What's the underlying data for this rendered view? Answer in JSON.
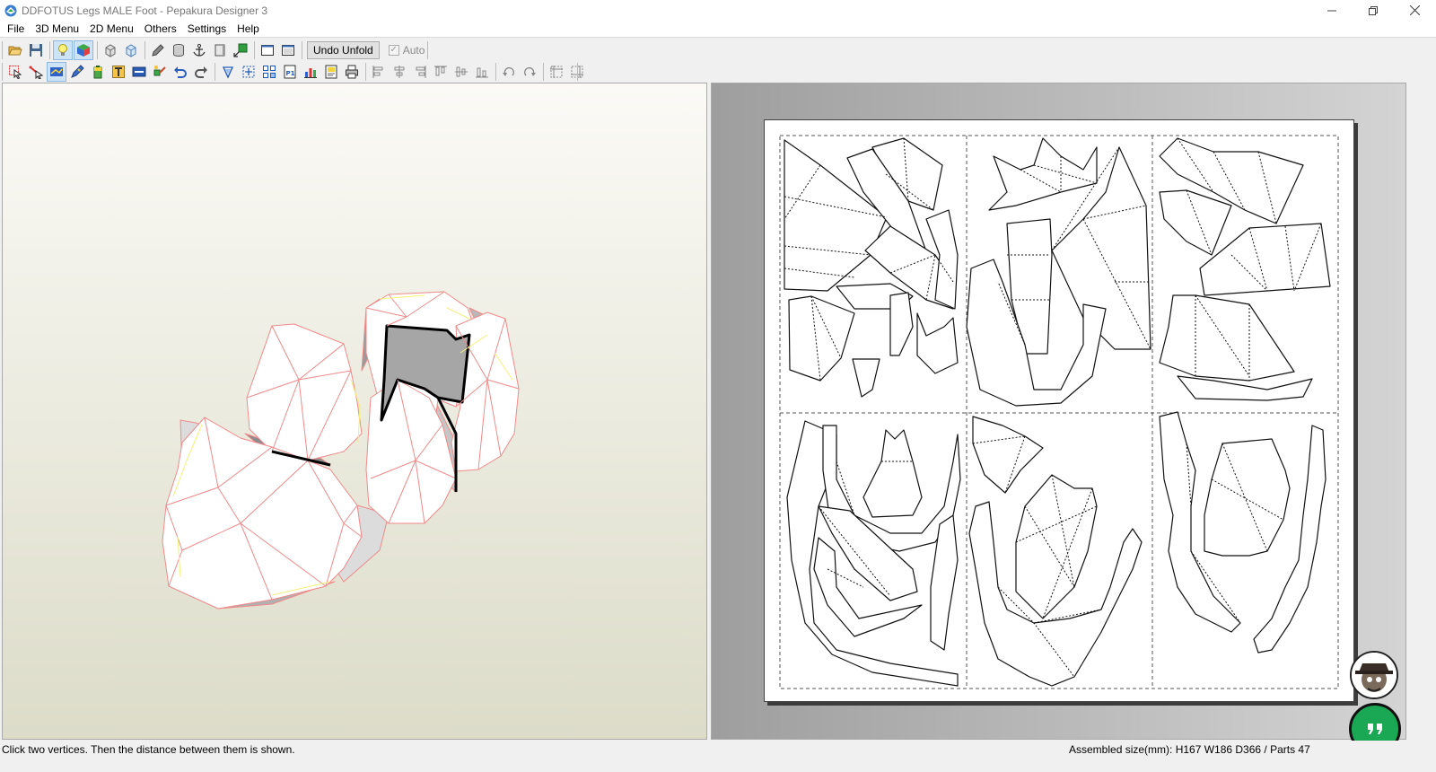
{
  "window": {
    "title": "DDFOTUS Legs MALE Foot - Pepakura Designer 3",
    "minimize_icon": "minimize-icon",
    "maximize_icon": "restore-icon",
    "close_icon": "close-icon"
  },
  "menu": {
    "items": [
      "File",
      "3D Menu",
      "2D Menu",
      "Others",
      "Settings",
      "Help"
    ]
  },
  "toolbar1": {
    "undo_unfold_label": "Undo Unfold",
    "auto_label": "Auto",
    "auto_checked": true,
    "icons": [
      "open-file-icon",
      "save-icon",
      "light-icon",
      "texture-cube-icon",
      "unfold-icon",
      "paper-cube-icon",
      "pencil-icon",
      "cylinder-icon",
      "anchor-icon",
      "box-icon",
      "green-box-icon",
      "single-view-icon",
      "split-view-icon"
    ]
  },
  "toolbar2": {
    "icons": [
      "select-icon",
      "edge-select-icon",
      "fold-lines-icon",
      "pencil-tool-icon",
      "battery-icon",
      "text-tool-icon",
      "image-icon",
      "join-icon",
      "undo-icon",
      "redo-icon",
      "rotate-part-icon",
      "move-part-icon",
      "scale-part-icon",
      "page-p1-icon",
      "chart-icon",
      "print-preview-icon",
      "print-icon",
      "align-left-icon",
      "align-center-icon",
      "align-right-icon",
      "align-top-icon",
      "align-middle-icon",
      "align-bottom-icon",
      "rotate-90-left-icon",
      "rotate-90-right-icon",
      "layout-grid-icon",
      "layout-fit-icon"
    ]
  },
  "status": {
    "hint": "Click two vertices. Then the distance between them is shown.",
    "assembled": "Assembled size(mm): H167 W186 D366 / Parts 47"
  },
  "colors": {
    "model_edge": "#f08a8a",
    "model_flap": "#f4f07a",
    "selected_face": "#a6a6a6",
    "chat_green": "#1aa854"
  }
}
